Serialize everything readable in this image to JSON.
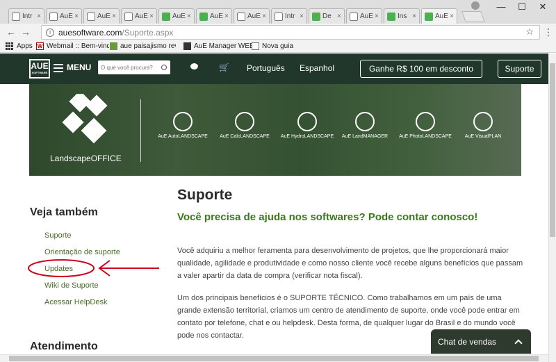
{
  "browser": {
    "tabs": [
      {
        "label": "Intr",
        "icon": "doc"
      },
      {
        "label": "AuE",
        "icon": "doc"
      },
      {
        "label": "AuE",
        "icon": "doc"
      },
      {
        "label": "AuE",
        "icon": "doc"
      },
      {
        "label": "AuE",
        "icon": "green"
      },
      {
        "label": "AuE",
        "icon": "green"
      },
      {
        "label": "AuE",
        "icon": "doc"
      },
      {
        "label": "Intr",
        "icon": "doc"
      },
      {
        "label": "De",
        "icon": "green"
      },
      {
        "label": "AuE",
        "icon": "doc"
      },
      {
        "label": "Ins",
        "icon": "green"
      },
      {
        "label": "AuE",
        "icon": "green"
      }
    ],
    "url_domain": "auesoftware.com",
    "url_path": "/Suporte.aspx",
    "bookmarks": [
      {
        "label": "Apps"
      },
      {
        "label": "Webmail :: Bem-vindo"
      },
      {
        "label": "aue paisajismo revista"
      },
      {
        "label": "AuE Manager WEB"
      },
      {
        "label": "Nova guia"
      }
    ]
  },
  "nav": {
    "logo_text": "AUE",
    "logo_sub": "SOFTWARE",
    "menu_label": "MENU",
    "search_placeholder": "O que você procura?",
    "lang_pt": "Português",
    "lang_es": "Espanhol",
    "discount_button": "Ganhe R$ 100 em desconto",
    "support_button": "Suporte"
  },
  "banner": {
    "brand": "LandscapeOFFICE",
    "products": [
      "AuE AutoLANDSCAPE",
      "AuE CalcLANDSCAPE",
      "AuE HydroLANDSCAPE",
      "AuE LandMANAGER",
      "AuE PhotoLANDSCAPE",
      "AuE VisualPLAN"
    ]
  },
  "sidebar": {
    "title": "Veja também",
    "items": [
      "Suporte",
      "Orientação de suporte",
      "Updates",
      "Wiki de Suporte",
      "Acessar HelpDesk"
    ],
    "section2_title": "Atendimento"
  },
  "content": {
    "title": "Suporte",
    "subtitle": "Você precisa de ajuda nos softwares? Pode contar conosco!",
    "p1": "Você adquiriu a melhor feramenta para desenvolvimento de projetos, que lhe proporcionará maior qualidade, agilidade e produtividade e como nosso cliente você recebe alguns benefícios que passam a valer apartir da data de compra (verificar nota fiscal).",
    "p2": "Um dos principais benefícios é o SUPORTE TÉCNICO. Como trabalhamos em um país de uma grande extensão territorial, criamos um centro de atendimento de suporte, onde você pode entrar em contato por telefone, chat e ou helpdesk. Desta forma, de qualquer lugar do Brasil e do mundo você pode nos contactar."
  },
  "chat": {
    "label": "Chat de vendas"
  },
  "colors": {
    "nav_bg": "#22372c",
    "accent_green": "#3a7a16",
    "annotation": "#d0021b"
  }
}
